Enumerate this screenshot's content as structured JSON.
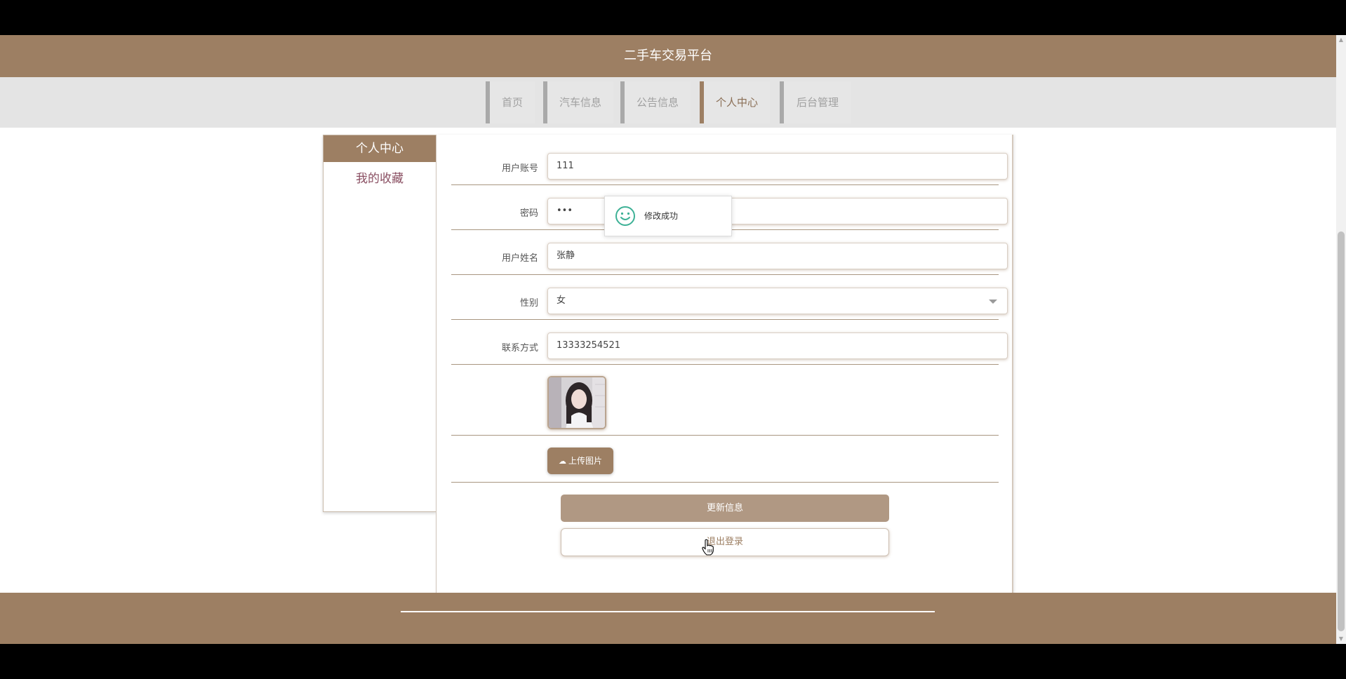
{
  "header": {
    "title": "二手车交易平台"
  },
  "nav": {
    "items": [
      {
        "label": "首页"
      },
      {
        "label": "汽车信息"
      },
      {
        "label": "公告信息"
      },
      {
        "label": "个人中心"
      },
      {
        "label": "后台管理"
      }
    ],
    "active": "个人中心"
  },
  "sidebar": {
    "title": "个人中心",
    "links": [
      {
        "label": "我的收藏"
      }
    ]
  },
  "form": {
    "account": {
      "label": "用户账号",
      "value": "111"
    },
    "password": {
      "label": "密码",
      "value": "•••"
    },
    "name": {
      "label": "用户姓名",
      "value": "张静"
    },
    "gender": {
      "label": "性别",
      "value": "女"
    },
    "phone": {
      "label": "联系方式",
      "value": "13333254521"
    },
    "upload_label": "上传图片",
    "update_label": "更新信息",
    "logout_label": "退出登录"
  },
  "toast": {
    "message": "修改成功",
    "icon": "smile-icon"
  },
  "colors": {
    "brand": "#9d7f63",
    "update_button": "#b09883",
    "link": "#8a4f62",
    "toast_icon": "#3eb196"
  }
}
